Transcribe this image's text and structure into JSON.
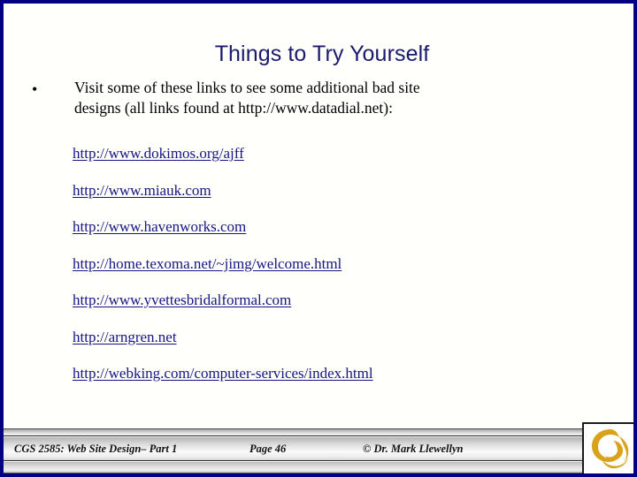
{
  "slide": {
    "title": "Things to Try Yourself",
    "title_color": "#1a1a6e",
    "border_color": "#000080",
    "background_color": "#fffffc"
  },
  "bullet": {
    "marker": "•",
    "line1": "Visit some of these links to see some additional bad site",
    "line2": "designs (all links found at http://www.datadial.net):"
  },
  "links": {
    "color": "#151586",
    "items": [
      {
        "label": "http://www.dokimos.org/ajff"
      },
      {
        "label": "http://www.miauk.com"
      },
      {
        "label": "http://www.havenworks.com"
      },
      {
        "label": "http://home.texoma.net/~jimg/welcome.html"
      },
      {
        "label": "http://www.yvettesbridalformal.com"
      },
      {
        "label": "http://arngren.net"
      },
      {
        "label": "http://webking.com/computer-services/index.html"
      }
    ]
  },
  "footer": {
    "course": "CGS 2585: Web Site Design– Part 1",
    "page": "Page 46",
    "copyright": "© Dr. Mark Llewellyn",
    "logo_color": "#d9a21b",
    "logo_name": "ucf-pegasus-logo"
  }
}
